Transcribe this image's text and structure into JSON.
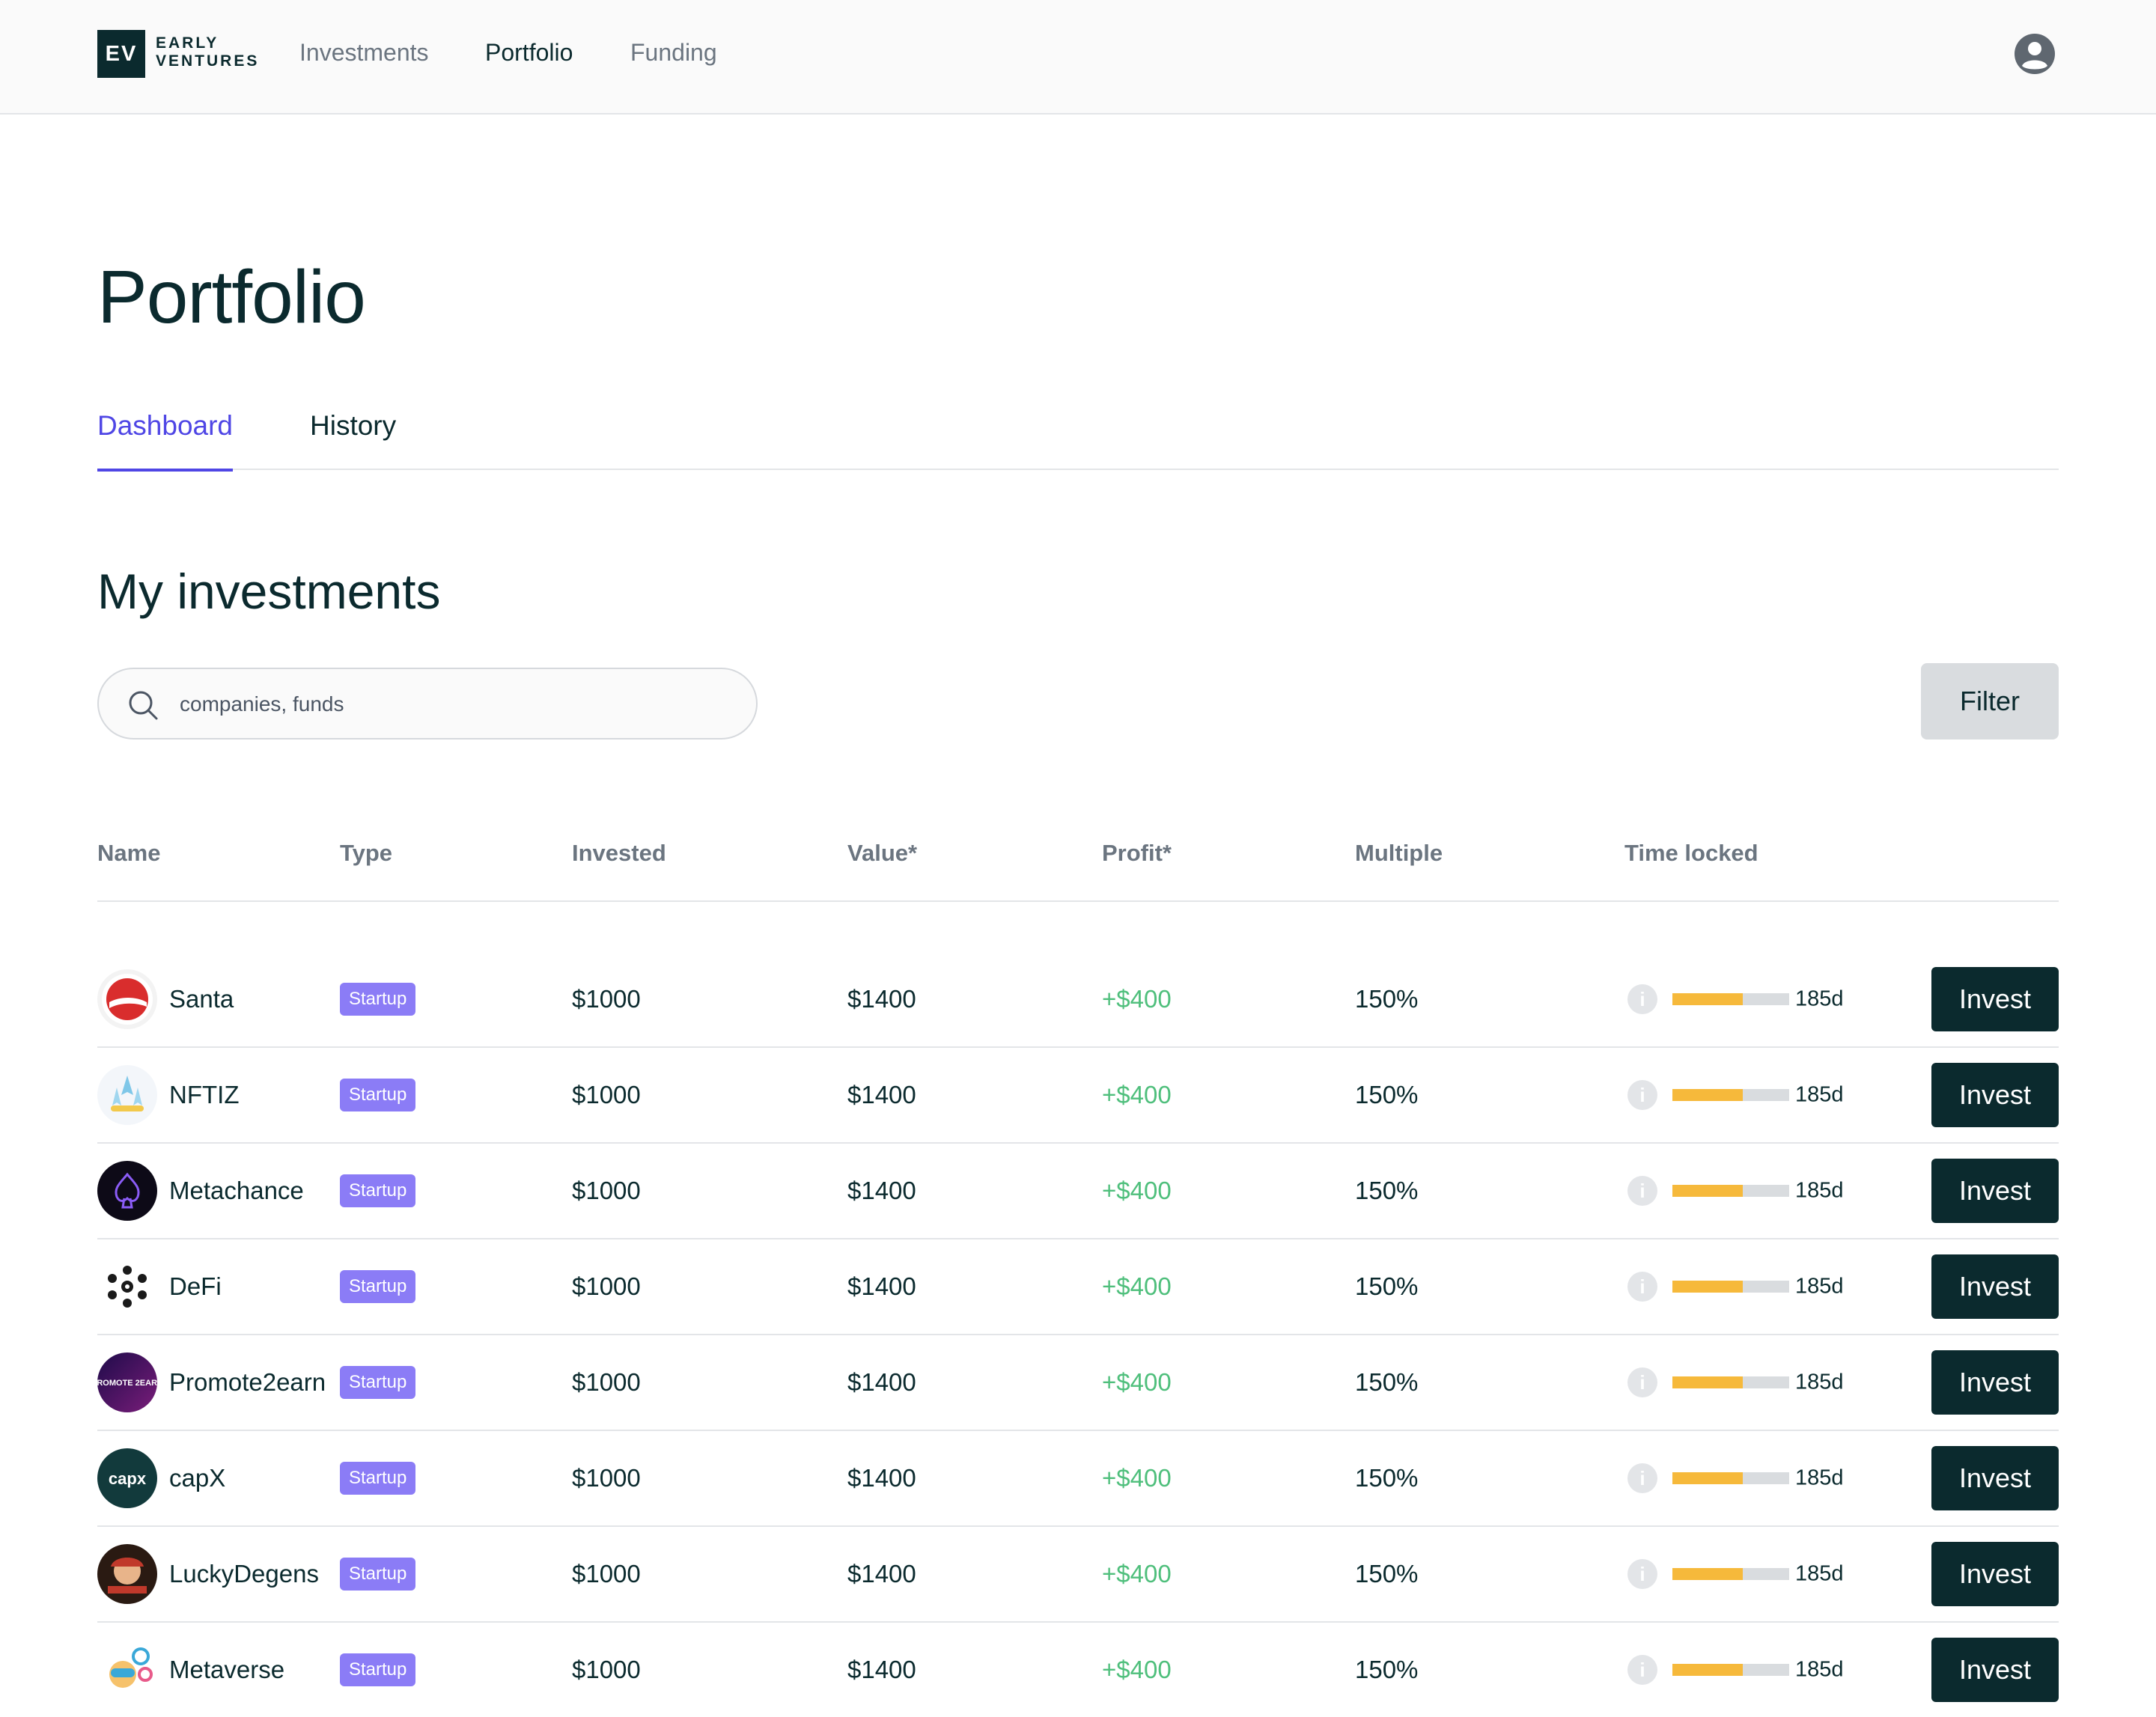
{
  "app": {
    "logo_abbr": "EV",
    "logo_line1": "EARLY",
    "logo_line2": "VENTURES"
  },
  "nav": {
    "items": [
      {
        "label": "Investments",
        "active": false
      },
      {
        "label": "Portfolio",
        "active": true
      },
      {
        "label": "Funding",
        "active": false
      }
    ],
    "avatar_icon": "user-circle-icon"
  },
  "page": {
    "title": "Portfolio",
    "tabs": [
      {
        "label": "Dashboard",
        "active": true
      },
      {
        "label": "History",
        "active": false
      }
    ],
    "section_title": "My investments"
  },
  "search": {
    "placeholder": "companies, funds",
    "value": "",
    "icon": "search-icon"
  },
  "filter": {
    "label": "Filter"
  },
  "table": {
    "columns": [
      "Name",
      "Type",
      "Invested",
      "Value*",
      "Profit*",
      "Multiple",
      "Time locked"
    ],
    "rows": [
      {
        "name": "Santa",
        "type": "Startup",
        "invested": "$1000",
        "value": "$1400",
        "profit": "+$400",
        "multiple": "150%",
        "locked_fraction": 0.6,
        "days": "185d",
        "action": "Invest",
        "logo": "santa-logo"
      },
      {
        "name": "NFTIZ",
        "type": "Startup",
        "invested": "$1000",
        "value": "$1400",
        "profit": "+$400",
        "multiple": "150%",
        "locked_fraction": 0.6,
        "days": "185d",
        "action": "Invest",
        "logo": "nftiz-logo"
      },
      {
        "name": "Metachance",
        "type": "Startup",
        "invested": "$1000",
        "value": "$1400",
        "profit": "+$400",
        "multiple": "150%",
        "locked_fraction": 0.6,
        "days": "185d",
        "action": "Invest",
        "logo": "metachance-logo"
      },
      {
        "name": "DeFi",
        "type": "Startup",
        "invested": "$1000",
        "value": "$1400",
        "profit": "+$400",
        "multiple": "150%",
        "locked_fraction": 0.6,
        "days": "185d",
        "action": "Invest",
        "logo": "defi-logo"
      },
      {
        "name": "Promote2earn",
        "type": "Startup",
        "invested": "$1000",
        "value": "$1400",
        "profit": "+$400",
        "multiple": "150%",
        "locked_fraction": 0.6,
        "days": "185d",
        "action": "Invest",
        "logo": "promote2earn-logo",
        "logo_text": "PROMOTE 2EARN"
      },
      {
        "name": "capX",
        "type": "Startup",
        "invested": "$1000",
        "value": "$1400",
        "profit": "+$400",
        "multiple": "150%",
        "locked_fraction": 0.6,
        "days": "185d",
        "action": "Invest",
        "logo": "capx-logo",
        "logo_text": "capx"
      },
      {
        "name": "LuckyDegens",
        "type": "Startup",
        "invested": "$1000",
        "value": "$1400",
        "profit": "+$400",
        "multiple": "150%",
        "locked_fraction": 0.6,
        "days": "185d",
        "action": "Invest",
        "logo": "luckydegens-logo"
      },
      {
        "name": "Metaverse",
        "type": "Startup",
        "invested": "$1000",
        "value": "$1400",
        "profit": "+$400",
        "multiple": "150%",
        "locked_fraction": 0.6,
        "days": "185d",
        "action": "Invest",
        "logo": "metaverse-logo"
      }
    ]
  },
  "colors": {
    "brand_dark": "#0b2a2e",
    "accent": "#4f46e5",
    "badge": "#8b7cf6",
    "profit": "#4fbf7c",
    "lock_bar": "#f6b93b"
  }
}
